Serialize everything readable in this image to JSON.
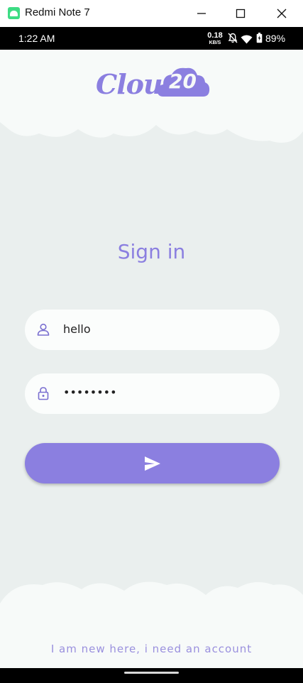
{
  "window": {
    "title": "Redmi Note 7"
  },
  "status_bar": {
    "time": "1:22 AM",
    "net_speed_value": "0.18",
    "net_speed_unit": "KB/S",
    "battery_percent": "89%",
    "icons": [
      "mute-bell-icon",
      "wifi-icon",
      "battery-icon"
    ]
  },
  "app": {
    "logo": {
      "word": "Cloud",
      "number": "20"
    },
    "heading": "Sign in",
    "username_field": {
      "value": "hello",
      "icon": "user-icon"
    },
    "password_field": {
      "value": "••••••••",
      "icon": "lock-icon"
    },
    "submit_icon": "send-icon",
    "register_link": "I am new here, i need an account"
  },
  "colors": {
    "accent": "#8b7fe0",
    "background": "#eaefee",
    "cloud": "#f7faf9"
  }
}
